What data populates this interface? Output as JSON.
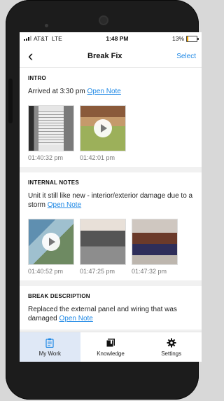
{
  "status_bar": {
    "carrier": "AT&T",
    "network": "LTE",
    "time": "1:48 PM",
    "battery": "13%"
  },
  "header": {
    "title": "Break Fix",
    "select_label": "Select",
    "back_icon": "chevron-left-icon"
  },
  "intro": {
    "heading": "INTRO",
    "text": "Arrived at 3:30 pm",
    "link": "Open Note",
    "media": [
      {
        "type": "photo",
        "time": "01:40:32 pm"
      },
      {
        "type": "video",
        "time": "01:42:01 pm"
      }
    ]
  },
  "internal_notes": {
    "heading": "INTERNAL NOTES",
    "text": "Unit it still like new - interior/exterior damage due to a storm",
    "link": "Open Note",
    "media": [
      {
        "type": "video",
        "time": "01:40:52 pm"
      },
      {
        "type": "photo",
        "time": "01:47:25 pm"
      },
      {
        "type": "photo",
        "time": "01:47:32 pm"
      }
    ]
  },
  "break_description": {
    "heading": "BREAK DESCRIPTION",
    "text": "Replaced the external panel and wiring that was damaged",
    "link": "Open Note"
  },
  "tabs": [
    {
      "label": "My Work",
      "icon": "clipboard-icon",
      "active": true
    },
    {
      "label": "Knowledge",
      "icon": "book-icon",
      "active": false
    },
    {
      "label": "Settings",
      "icon": "gear-icon",
      "active": false
    }
  ],
  "colors": {
    "accent": "#1e88e5",
    "active_tab_bg": "#dfe8f6",
    "battery": "#f0a300"
  }
}
